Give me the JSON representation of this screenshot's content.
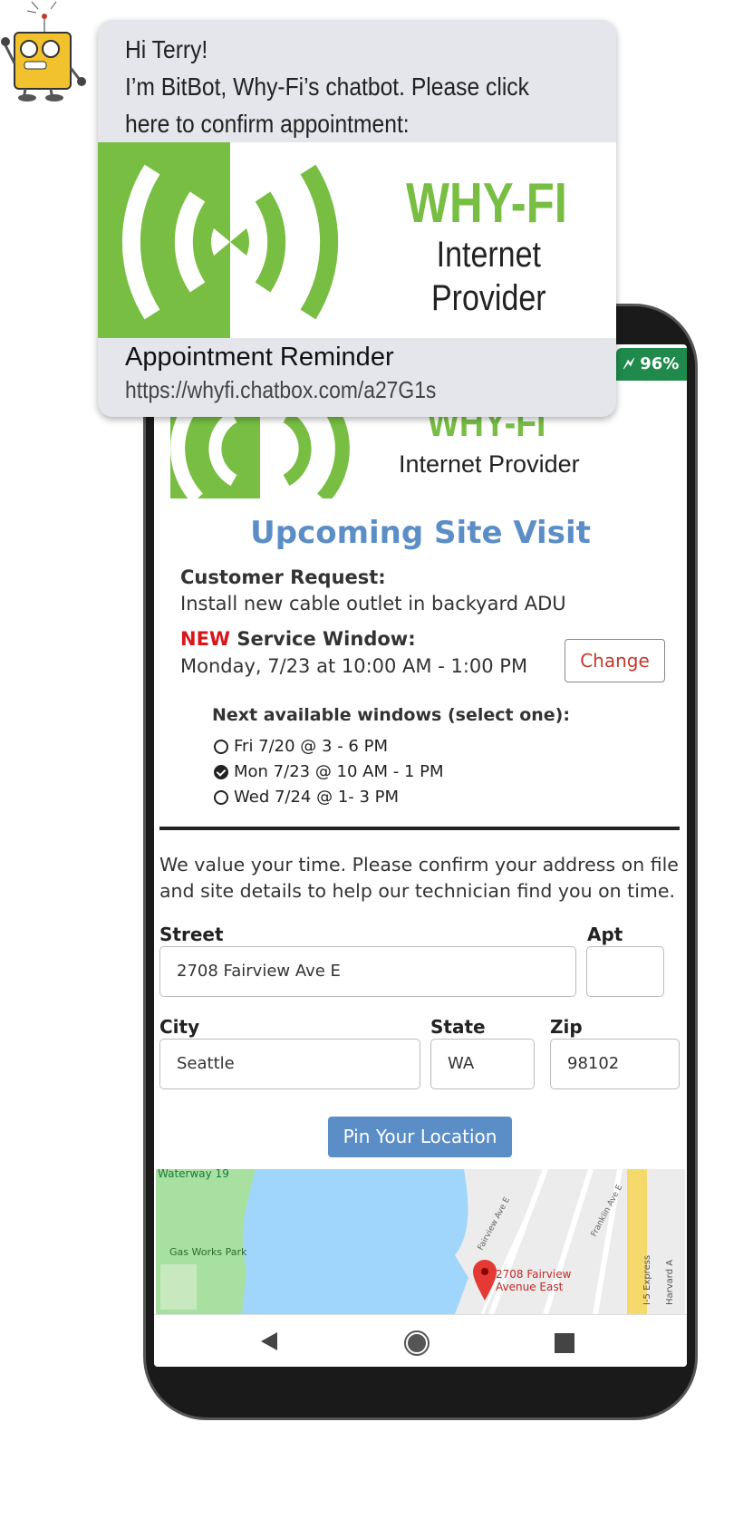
{
  "chat": {
    "greeting": "Hi Terry!",
    "line2": "I’m BitBot, Why-Fi’s chatbot. Please click",
    "line3": "here to confirm appointment:",
    "card": {
      "brand": "WHY-FI",
      "tagline_1": "Internet",
      "tagline_2": "Provider",
      "title": "Appointment Reminder",
      "url": "https://whyfi.chatbox.com/a27G1s"
    }
  },
  "status": {
    "battery": "96%"
  },
  "page": {
    "brand": "WHY-FI",
    "tagline": "Internet Provider",
    "title": "Upcoming Site Visit",
    "request_label": "Customer Request:",
    "request_value": "Install new cable outlet in backyard ADU",
    "window_new": "NEW",
    "window_label": "Service Window:",
    "window_value": "Monday, 7/23 at 10:00 AM - 1:00 PM",
    "change_label": "Change",
    "options_title": "Next available windows (select one):",
    "options": [
      {
        "label": "Fri 7/20 @ 3 - 6 PM",
        "selected": false
      },
      {
        "label": "Mon 7/23 @ 10 AM - 1 PM",
        "selected": true
      },
      {
        "label": "Wed 7/24 @ 1- 3 PM",
        "selected": false
      }
    ],
    "intro": "We value your time. Please confirm your address on file and site details to help our technician find you on time.",
    "form": {
      "street_label": "Street",
      "street": "2708 Fairview Ave E",
      "apt_label": "Apt",
      "apt": "",
      "city_label": "City",
      "city": "Seattle",
      "state_label": "State",
      "state": "WA",
      "zip_label": "Zip",
      "zip": "98102"
    },
    "pin_label": "Pin Your Location",
    "map": {
      "labels": [
        "Waterway 19",
        "Gas Works Park",
        "Fairview Ave E",
        "Franklin Ave E",
        "I-5 Express",
        "Harvard A",
        "5"
      ],
      "marker": "2708 Fairview Avenue East"
    }
  },
  "colors": {
    "brand_green": "#78be43",
    "accent_blue": "#5b8ec7",
    "alert_red": "#d9161c"
  }
}
